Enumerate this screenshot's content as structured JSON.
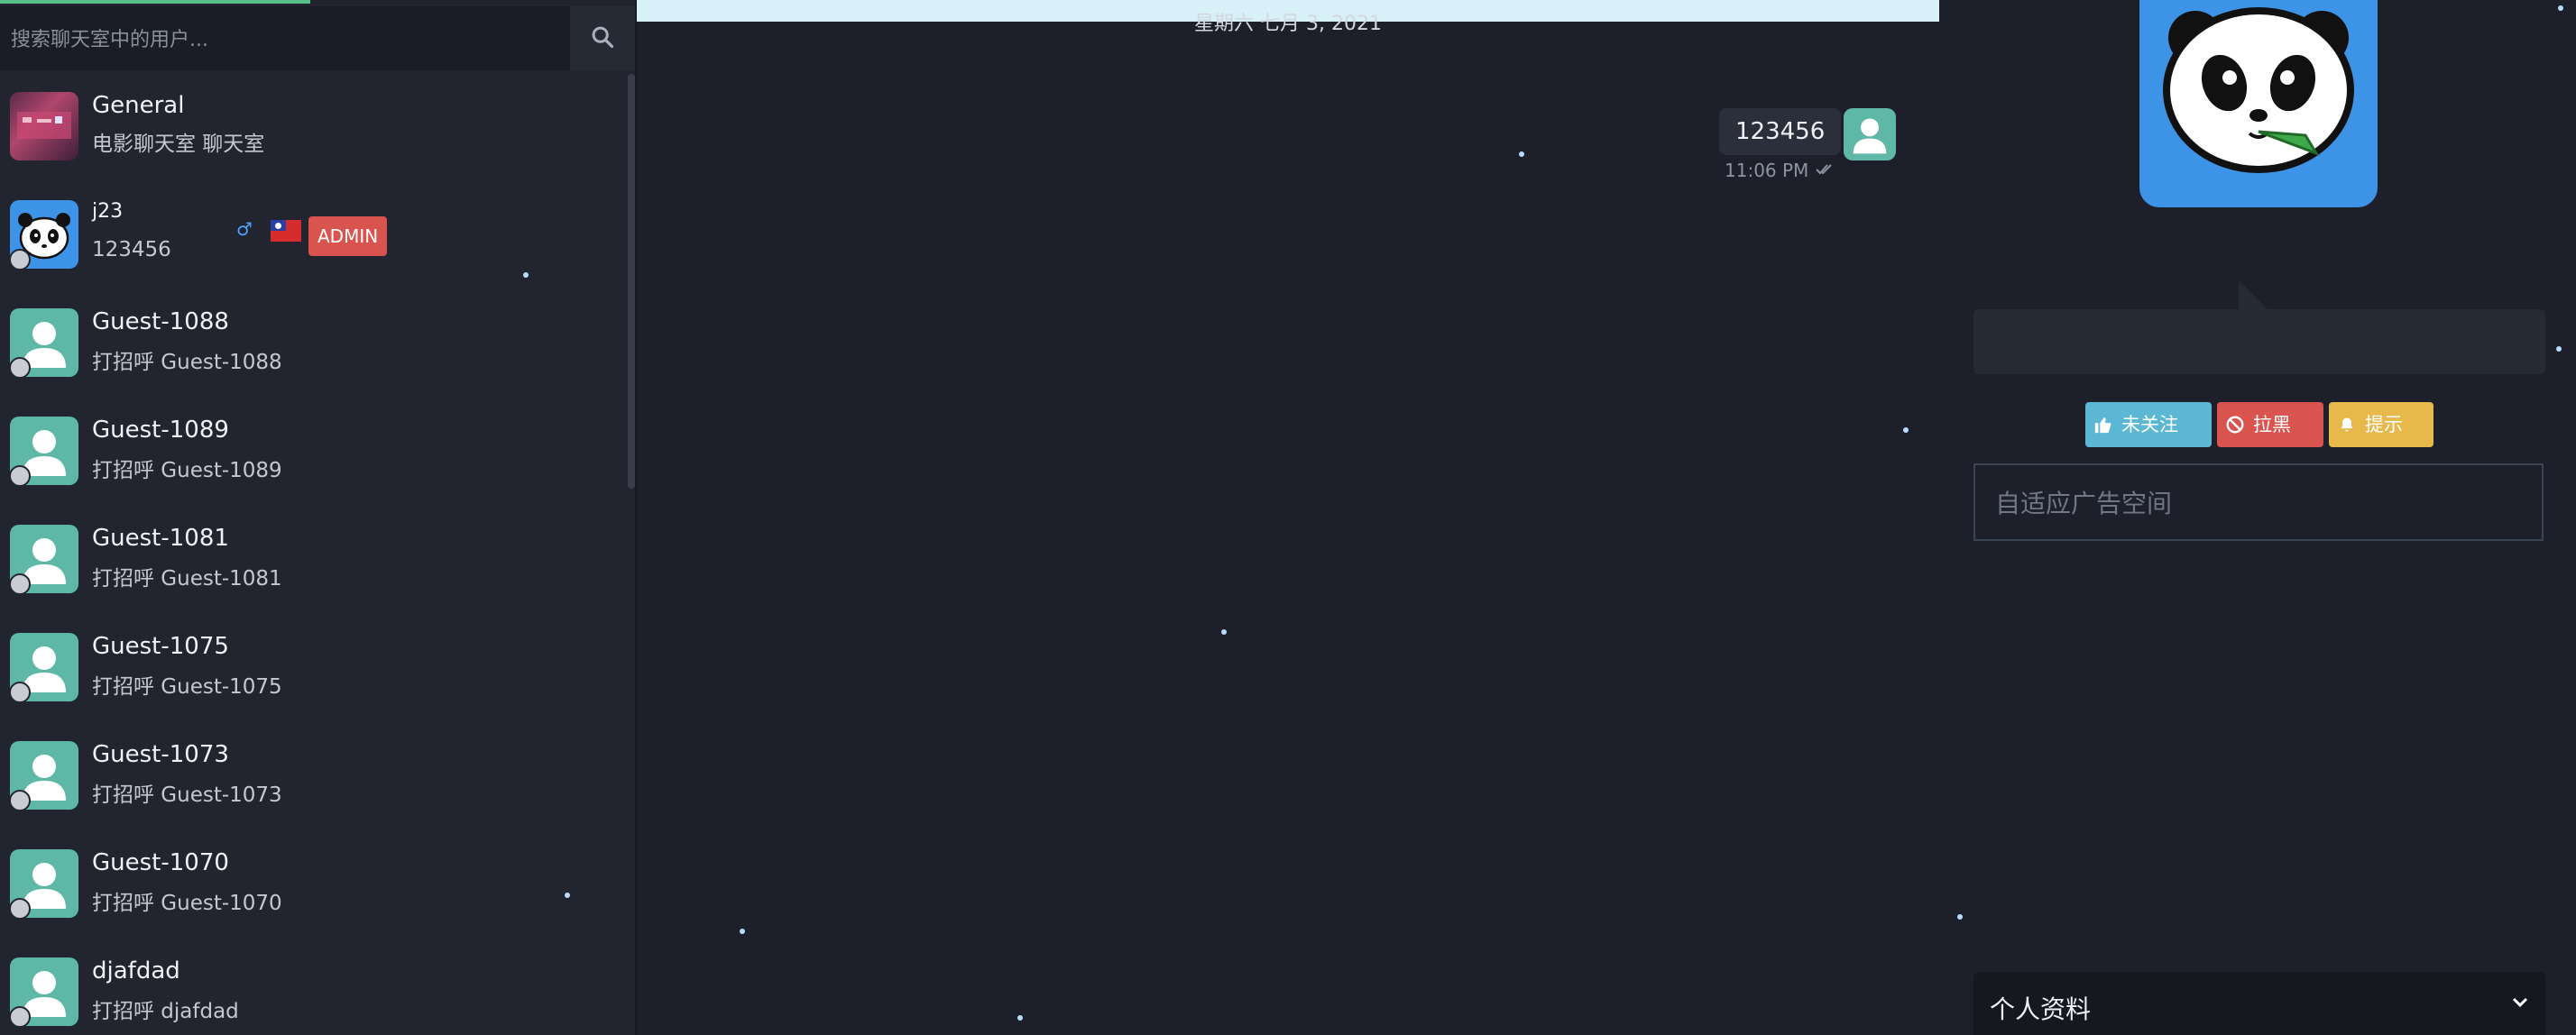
{
  "sidebar": {
    "search": {
      "placeholder": "搜索聊天室中的用户..."
    },
    "items": [
      {
        "name": "General",
        "message": "电影聊天室 聊天室",
        "avatar": "room",
        "status": false
      },
      {
        "name": "j23",
        "message": "123456",
        "avatar": "panda",
        "status": true,
        "gender": "♂",
        "badge": "ADMIN"
      },
      {
        "name": "Guest-1088",
        "message": "打招呼 Guest-1088",
        "avatar": "default",
        "status": true
      },
      {
        "name": "Guest-1089",
        "message": "打招呼 Guest-1089",
        "avatar": "default",
        "status": true
      },
      {
        "name": "Guest-1081",
        "message": "打招呼 Guest-1081",
        "avatar": "default",
        "status": true
      },
      {
        "name": "Guest-1075",
        "message": "打招呼 Guest-1075",
        "avatar": "default",
        "status": true
      },
      {
        "name": "Guest-1073",
        "message": "打招呼 Guest-1073",
        "avatar": "default",
        "status": true
      },
      {
        "name": "Guest-1070",
        "message": "打招呼 Guest-1070",
        "avatar": "default",
        "status": true
      },
      {
        "name": "djafdad",
        "message": "打招呼 djafdad",
        "avatar": "default",
        "status": true
      }
    ]
  },
  "chat": {
    "date": "星期六 七月 3, 2021",
    "message": {
      "text": "123456",
      "time": "11:06 PM"
    }
  },
  "right_panel": {
    "buttons": {
      "follow": "未关注",
      "block": "拉黑",
      "alert": "提示"
    },
    "ad_placeholder": "自适应广告空间",
    "profile_section": "个人资料"
  },
  "colors": {
    "background": "#1d202a",
    "sidebar": "#22252f",
    "admin_badge": "#d9534f",
    "follow_button": "#5bb7d3",
    "block_button": "#d9534f",
    "alert_button": "#e7b84a",
    "avatar_default": "#5fb7a8",
    "avatar_panda_bg": "#3d93e6"
  }
}
